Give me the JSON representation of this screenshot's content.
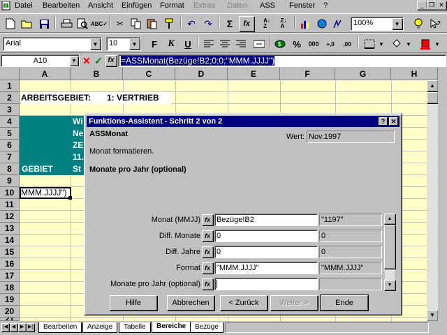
{
  "menu": {
    "items": [
      "Datei",
      "Bearbeiten",
      "Ansicht",
      "Einfügen",
      "Format",
      "Extras",
      "Daten",
      "ASS",
      "Fenster",
      "?"
    ],
    "disabled": [
      false,
      false,
      false,
      false,
      false,
      true,
      true,
      false,
      false,
      false
    ]
  },
  "toolbar": {
    "zoom": "100%",
    "font": "Arial",
    "size": "10",
    "bold_label": "F",
    "italic_label": "K",
    "underline_label": "U",
    "sum_label": "Σ",
    "fx_label": "fx",
    "percent_label": "%",
    "thousand_label": "000",
    "dec_inc_label": "+,0",
    "dec_dec_label": ",00"
  },
  "formula": {
    "cell_ref": "A10",
    "cancel": "✕",
    "confirm": "✓",
    "fx": "fx",
    "content": "=ASSMonat(Bezüge!B2;0;0;\"MMM.JJJJ\")"
  },
  "sheet": {
    "columns": [
      "A",
      "B",
      "C",
      "D",
      "E",
      "F",
      "G",
      "H"
    ],
    "rows": [
      "1",
      "2",
      "3",
      "4",
      "5",
      "6",
      "7",
      "8",
      "9",
      "10",
      "11",
      "12",
      "13",
      "14",
      "15",
      "16",
      "17",
      "18",
      "19",
      "20",
      "21"
    ],
    "row2_label": "ARBEITSGEBIET:",
    "row2_value": "1: VERTRIEB",
    "row8_a": "GEBIET",
    "b_col": [
      "Wi",
      "Ne",
      "ZE",
      "11.",
      "St"
    ],
    "a10": "MMM.JJJJ\")"
  },
  "dialog": {
    "title": "Funktions-Assistent - Schritt 2 von 2",
    "help_icon": "?",
    "close_icon": "✕",
    "function_name": "ASSMonat",
    "wert_label": "Wert:",
    "wert_value": "Nov.1997",
    "description": "Monat formatieren.",
    "current_arg": "Monate pro Jahr (optional)",
    "args": [
      {
        "label": "Monat (MMJJ)",
        "input": "Bezüge!B2",
        "value": "\"1197\""
      },
      {
        "label": "Diff. Monate",
        "input": "0",
        "value": "0"
      },
      {
        "label": "Diff. Jahre",
        "input": "0",
        "value": "0"
      },
      {
        "label": "Format",
        "input": "\"MMM.JJJJ\"",
        "value": "\"MMM.JJJJ\""
      },
      {
        "label": "Monate pro Jahr (optional)",
        "input": "",
        "value": ""
      }
    ],
    "buttons": {
      "help": "Hilfe",
      "cancel": "Abbrechen",
      "back": "< Zurück",
      "next": "Weiter >",
      "finish": "Ende"
    }
  },
  "tabs": {
    "items": [
      "Bearbeiten",
      "Anzeige",
      "Tabelle",
      "Bereiche",
      "Bezüge"
    ],
    "active": "Bereiche"
  },
  "colors": {
    "teal": "#008080",
    "sheet_bg": "#ffffc8",
    "title_bar": "#000080"
  }
}
